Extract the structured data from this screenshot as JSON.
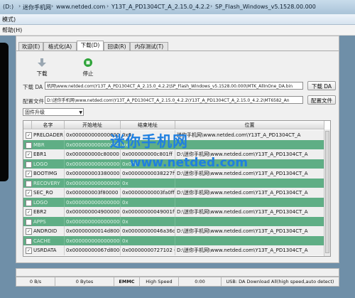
{
  "path_bar": {
    "items": [
      "(D:)",
      "迷你手机网",
      "www.netded.com",
      "Y13T_A_PD1304CT_A_2.15.0_4.2.2",
      "SP_Flash_Windows_v5.1528.00.000"
    ]
  },
  "window": {
    "title": "模式)"
  },
  "menu": {
    "help": "帮助(H)"
  },
  "tabs": [
    {
      "label": "欢迎(E)"
    },
    {
      "label": "格式化(A)"
    },
    {
      "label": "下载(D)"
    },
    {
      "label": "回读(R)"
    },
    {
      "label": "内存测试(T)"
    }
  ],
  "toolbar": {
    "download_label": "下载",
    "stop_label": "停止",
    "download_icon": "down-arrow-icon",
    "stop_icon": "stop-icon"
  },
  "download_agent": {
    "label": "下载 DA",
    "value": "机网\\www.netded.com\\Y13T_A_PD1304CT_A_2.15.0_4.2.2\\SP_Flash_Windows_v5.1528.00.000\\MTK_AllInOne_DA.bin",
    "button": "下载 DA"
  },
  "scatter": {
    "label": "配置文件",
    "value": "D:\\迷你手机网\\www.netded.com\\Y13T_A_PD1304CT_A_2.15.0_4.2.2\\Y13T_A_PD1304CT_A_2.15.0_4.2.2\\MT6582_An",
    "button": "配置文件"
  },
  "mode_select": {
    "value": "固件升级"
  },
  "table": {
    "headers": [
      "名字",
      "开始地址",
      "结束地址",
      "位置"
    ],
    "rows": [
      {
        "checked": "✓",
        "name": "PRELOADER",
        "start": "0x0000000000000000",
        "end": "0x0",
        "location": "迷你手机网\\www.netded.com\\Y13T_A_PD1304CT_A"
      },
      {
        "checked": "",
        "name": "MBR",
        "start": "0x0000000000000000",
        "end": "0x",
        "location": ""
      },
      {
        "checked": "✓",
        "name": "EBR1",
        "start": "0x000000000c80000",
        "end": "0x000000000c801ff",
        "location": "D:\\迷你手机网\\www.netded.com\\Y13T_A_PD1304CT_A"
      },
      {
        "checked": "",
        "name": "LOGO",
        "start": "0x0000000000000000",
        "end": "0x000",
        "location": ""
      },
      {
        "checked": "✓",
        "name": "BOOTIMG",
        "start": "0x000000003380000",
        "end": "0x00000000038227ff",
        "location": "D:\\迷你手机网\\www.netded.com\\Y13T_A_PD1304CT_A"
      },
      {
        "checked": "",
        "name": "RECOVERY",
        "start": "0x0000000000000000",
        "end": "0x",
        "location": ""
      },
      {
        "checked": "✓",
        "name": "SEC_RO",
        "start": "0x000000003f80000",
        "end": "0x00000000003fa0fff",
        "location": "D:\\迷你手机网\\www.netded.com\\Y13T_A_PD1304CT_A"
      },
      {
        "checked": "",
        "name": "LOGO",
        "start": "0x0000000000000000",
        "end": "0x",
        "location": ""
      },
      {
        "checked": "✓",
        "name": "EBR2",
        "start": "0x000000004900000",
        "end": "0x00000000049001ff",
        "location": "D:\\迷你手机网\\www.netded.com\\Y13T_A_PD1304CT_A"
      },
      {
        "checked": "",
        "name": "APPS",
        "start": "0x0000000000000000",
        "end": "0x",
        "location": ""
      },
      {
        "checked": "✓",
        "name": "ANDROID",
        "start": "0x00000000014d80000",
        "end": "0x00000000046a36da3",
        "location": "D:\\迷你手机网\\www.netded.com\\Y13T_A_PD1304CT_A"
      },
      {
        "checked": "",
        "name": "CACHE",
        "start": "0x0000000000000000",
        "end": "0x",
        "location": ""
      },
      {
        "checked": "✓",
        "name": "USRDATA",
        "start": "0x00000000067d80000",
        "end": "0x00000000727102 67",
        "location": "D:\\迷你手机网\\www.netded.com\\Y13T_A_PD1304CT_A"
      }
    ]
  },
  "watermark": {
    "cn": "迷你手机网",
    "url": "www.netded.com"
  },
  "status_bar": {
    "speed": "0 B/s",
    "bytes": "0 Bytes",
    "chip": "EMMC",
    "high_speed": "High Speed",
    "time": "0:00",
    "info": "USB: DA Download All(high speed,auto detect)"
  },
  "colors": {
    "row_alt": "#5fae85",
    "watermark": "#1f7fe0"
  }
}
